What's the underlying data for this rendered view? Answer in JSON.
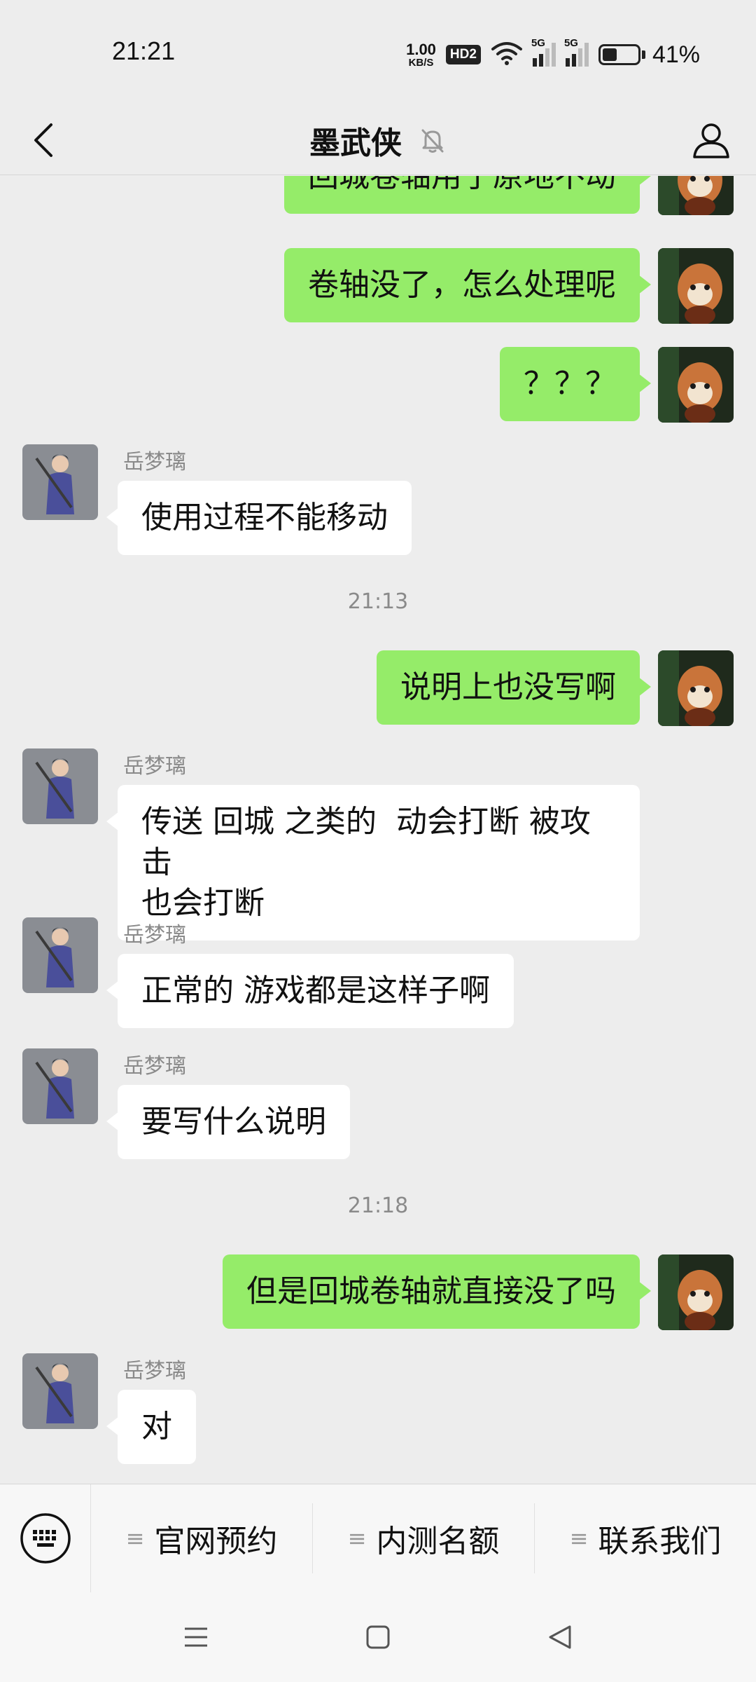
{
  "status_bar": {
    "time": "21:21",
    "net_speed_value": "1.00",
    "net_speed_unit": "KB/S",
    "hd_label": "HD2",
    "signal1_label": "5G",
    "signal2_label": "5G",
    "battery_level": 0.41,
    "battery_percent": "41%"
  },
  "header": {
    "title": "墨武侠",
    "icons": [
      "back-arrow-icon",
      "mute-bell-icon",
      "profile-icon"
    ]
  },
  "chat": {
    "messages": [
      {
        "dir": "out",
        "text": "回城卷轴用了原地不动"
      },
      {
        "dir": "out",
        "text": "卷轴没了，怎么处理呢"
      },
      {
        "dir": "out",
        "text": "？？？"
      },
      {
        "dir": "in",
        "sender": "岳梦璃",
        "text": "使用过程不能移动"
      },
      {
        "dir": "time",
        "text": "21:13"
      },
      {
        "dir": "out",
        "text": "说明上也没写啊"
      },
      {
        "dir": "in",
        "sender": "岳梦璃",
        "text": "传送 回城 之类的  动会打断 被攻击\n也会打断"
      },
      {
        "dir": "in",
        "sender": "岳梦璃",
        "text": "正常的 游戏都是这样子啊"
      },
      {
        "dir": "in",
        "sender": "岳梦璃",
        "text": "要写什么说明"
      },
      {
        "dir": "time",
        "text": "21:18"
      },
      {
        "dir": "out",
        "text": "但是回城卷轴就直接没了吗"
      },
      {
        "dir": "in",
        "sender": "岳梦璃",
        "text": "对"
      }
    ]
  },
  "menu": {
    "keyboard_icon": "keyboard-icon",
    "items": [
      {
        "label": "官网预约",
        "icon": "menu-lines-icon"
      },
      {
        "label": "内测名额",
        "icon": "menu-lines-icon"
      },
      {
        "label": "联系我们",
        "icon": "menu-lines-icon"
      }
    ]
  },
  "nav": {
    "icons": [
      "nav-menu-icon",
      "nav-home-icon",
      "nav-back-icon"
    ]
  },
  "colors": {
    "background": "#ededed",
    "bubble_out": "#95ec69",
    "bubble_in": "#ffffff",
    "muted_text": "#8a8a8a"
  }
}
